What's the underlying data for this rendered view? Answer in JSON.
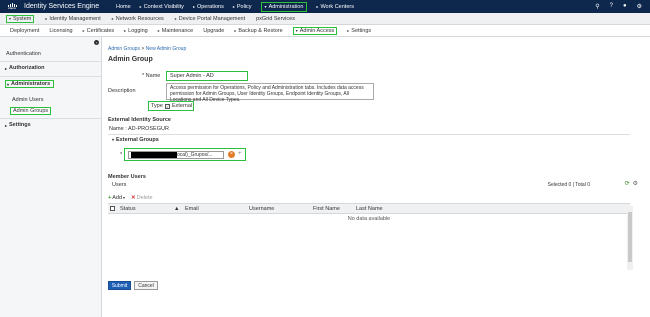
{
  "brand": {
    "logo_text": "cisco",
    "app_name": "Identity Services Engine"
  },
  "top_nav": [
    {
      "label": "Home"
    },
    {
      "label": "Context Visibility"
    },
    {
      "label": "Operations"
    },
    {
      "label": "Policy"
    },
    {
      "label": "Administration"
    },
    {
      "label": "Work Centers"
    }
  ],
  "top_icons": [
    "search-icon",
    "help-icon",
    "user-icon",
    "gear-icon"
  ],
  "second_nav": [
    {
      "label": "System"
    },
    {
      "label": "Identity Management"
    },
    {
      "label": "Network Resources"
    },
    {
      "label": "Device Portal Management"
    },
    {
      "label": "pxGrid Services"
    }
  ],
  "third_nav": [
    {
      "label": "Deployment"
    },
    {
      "label": "Licensing"
    },
    {
      "label": "Certificates"
    },
    {
      "label": "Logging"
    },
    {
      "label": "Maintenance"
    },
    {
      "label": "Upgrade"
    },
    {
      "label": "Backup & Restore"
    },
    {
      "label": "Admin Access"
    },
    {
      "label": "Settings"
    }
  ],
  "sidebar": {
    "items": [
      {
        "label": "Authentication"
      },
      {
        "label": "Authorization"
      },
      {
        "label": "Administrators"
      },
      {
        "label": "Admin Users"
      },
      {
        "label": "Admin Groups"
      },
      {
        "label": "Settings"
      }
    ]
  },
  "breadcrumb": {
    "parent": "Admin Groups",
    "separator": ">",
    "current": "New Admin Group"
  },
  "page_title": "Admin Group",
  "form": {
    "name_label": "Name",
    "name_value": "Super Admin - AD",
    "description_label": "Description",
    "description_value": "Access permission for Operations, Policy and Administration tabs. Includes data access permission for Admin Groups, User Identity Groups, Endpoint Identity Groups, All Locations and All Device Types.",
    "type_label": "Type",
    "type_option": "External",
    "type_checked": true,
    "required_mark": "*"
  },
  "external_identity": {
    "title": "External Identity Source",
    "name_label": "Name :",
    "name_value": "AD-PROSEGUR"
  },
  "external_groups": {
    "title": "External Groups",
    "value_suffix": "ocal)_Grupos/...",
    "required_mark": "*"
  },
  "member_users": {
    "title": "Member Users",
    "subtitle": "Users",
    "add_label": "Add",
    "delete_label": "Delete",
    "selection_info": "Selected 0 | Total 0",
    "columns": [
      "Status",
      "Email",
      "Username",
      "First Name",
      "Last Name"
    ],
    "empty_text": "No data available"
  },
  "buttons": {
    "submit": "Submit",
    "cancel": "Cancel"
  },
  "colors": {
    "topbar": "#0d274d",
    "highlight": "#2bbf3c",
    "link": "#2b6cb0",
    "submit": "#1d5fb5"
  }
}
